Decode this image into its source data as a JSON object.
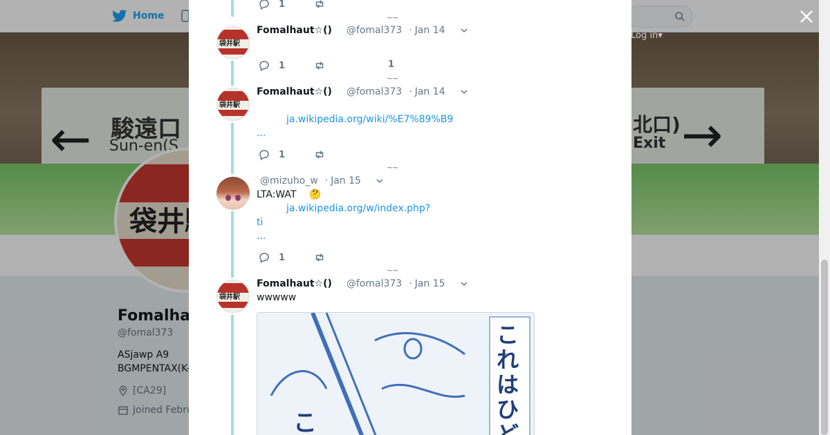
{
  "nav": {
    "home_label": "Home",
    "login_label": "Log in",
    "login_caret": "▾"
  },
  "banner": {
    "sign_left_jp": "駿遠口",
    "sign_left_en": "Sun-en(S",
    "sign_right_jp": "北口)",
    "sign_right_en": "Exit",
    "avatar_text": "袋井駅"
  },
  "profile": {
    "name": "Fomalhau",
    "handle": "@fomal373",
    "bio_line1": "ASjawp A9",
    "bio_line2": "BGMPENTAX(K-",
    "location": "[CA29]",
    "joined": "Joined Febru"
  },
  "conversation": {
    "tweets": [
      {
        "reply_count": "1",
        "retweet_count": ""
      },
      {
        "name": "Fomalhaut☆()",
        "handle": "@fomal373",
        "dot": "·",
        "date": "Jan 14",
        "reply_count": "1",
        "retweet_count": "",
        "like_count": "1"
      },
      {
        "name": "Fomalhaut☆()",
        "handle": "@fomal373",
        "dot": "·",
        "date": "Jan 14",
        "link": "ja.wikipedia.org/wiki/%E7%89%B9",
        "ellipsis": "...",
        "reply_count": "1",
        "retweet_count": ""
      },
      {
        "name": "",
        "handle": "@mizuho_w",
        "dot": "·",
        "date": "Jan 15",
        "text": "LTA:WAT",
        "emoji": "🤔",
        "link": "ja.wikipedia.org/w/index.php?",
        "link_cont": "ti",
        "ellipsis": "...",
        "reply_count": "1",
        "retweet_count": ""
      },
      {
        "name": "Fomalhaut☆()",
        "handle": "@fomal373",
        "dot": "·",
        "date": "Jan 15",
        "text": "wwwww",
        "image_text_1": "これはひど",
        "image_text_2": "こ"
      }
    ],
    "squiggle": "~~"
  },
  "icons": {
    "close": "close-icon",
    "reply": "reply-icon",
    "retweet": "retweet-icon",
    "caret": "chevron-down-icon",
    "twitter": "twitter-bird-icon",
    "search": "search-icon",
    "location": "location-icon",
    "calendar": "calendar-icon"
  },
  "colors": {
    "twitter_blue": "#1da1f2",
    "link_blue": "#1b95e0",
    "thread_line": "#a3dbe0",
    "text_primary": "#14171a",
    "text_secondary": "#657786"
  }
}
